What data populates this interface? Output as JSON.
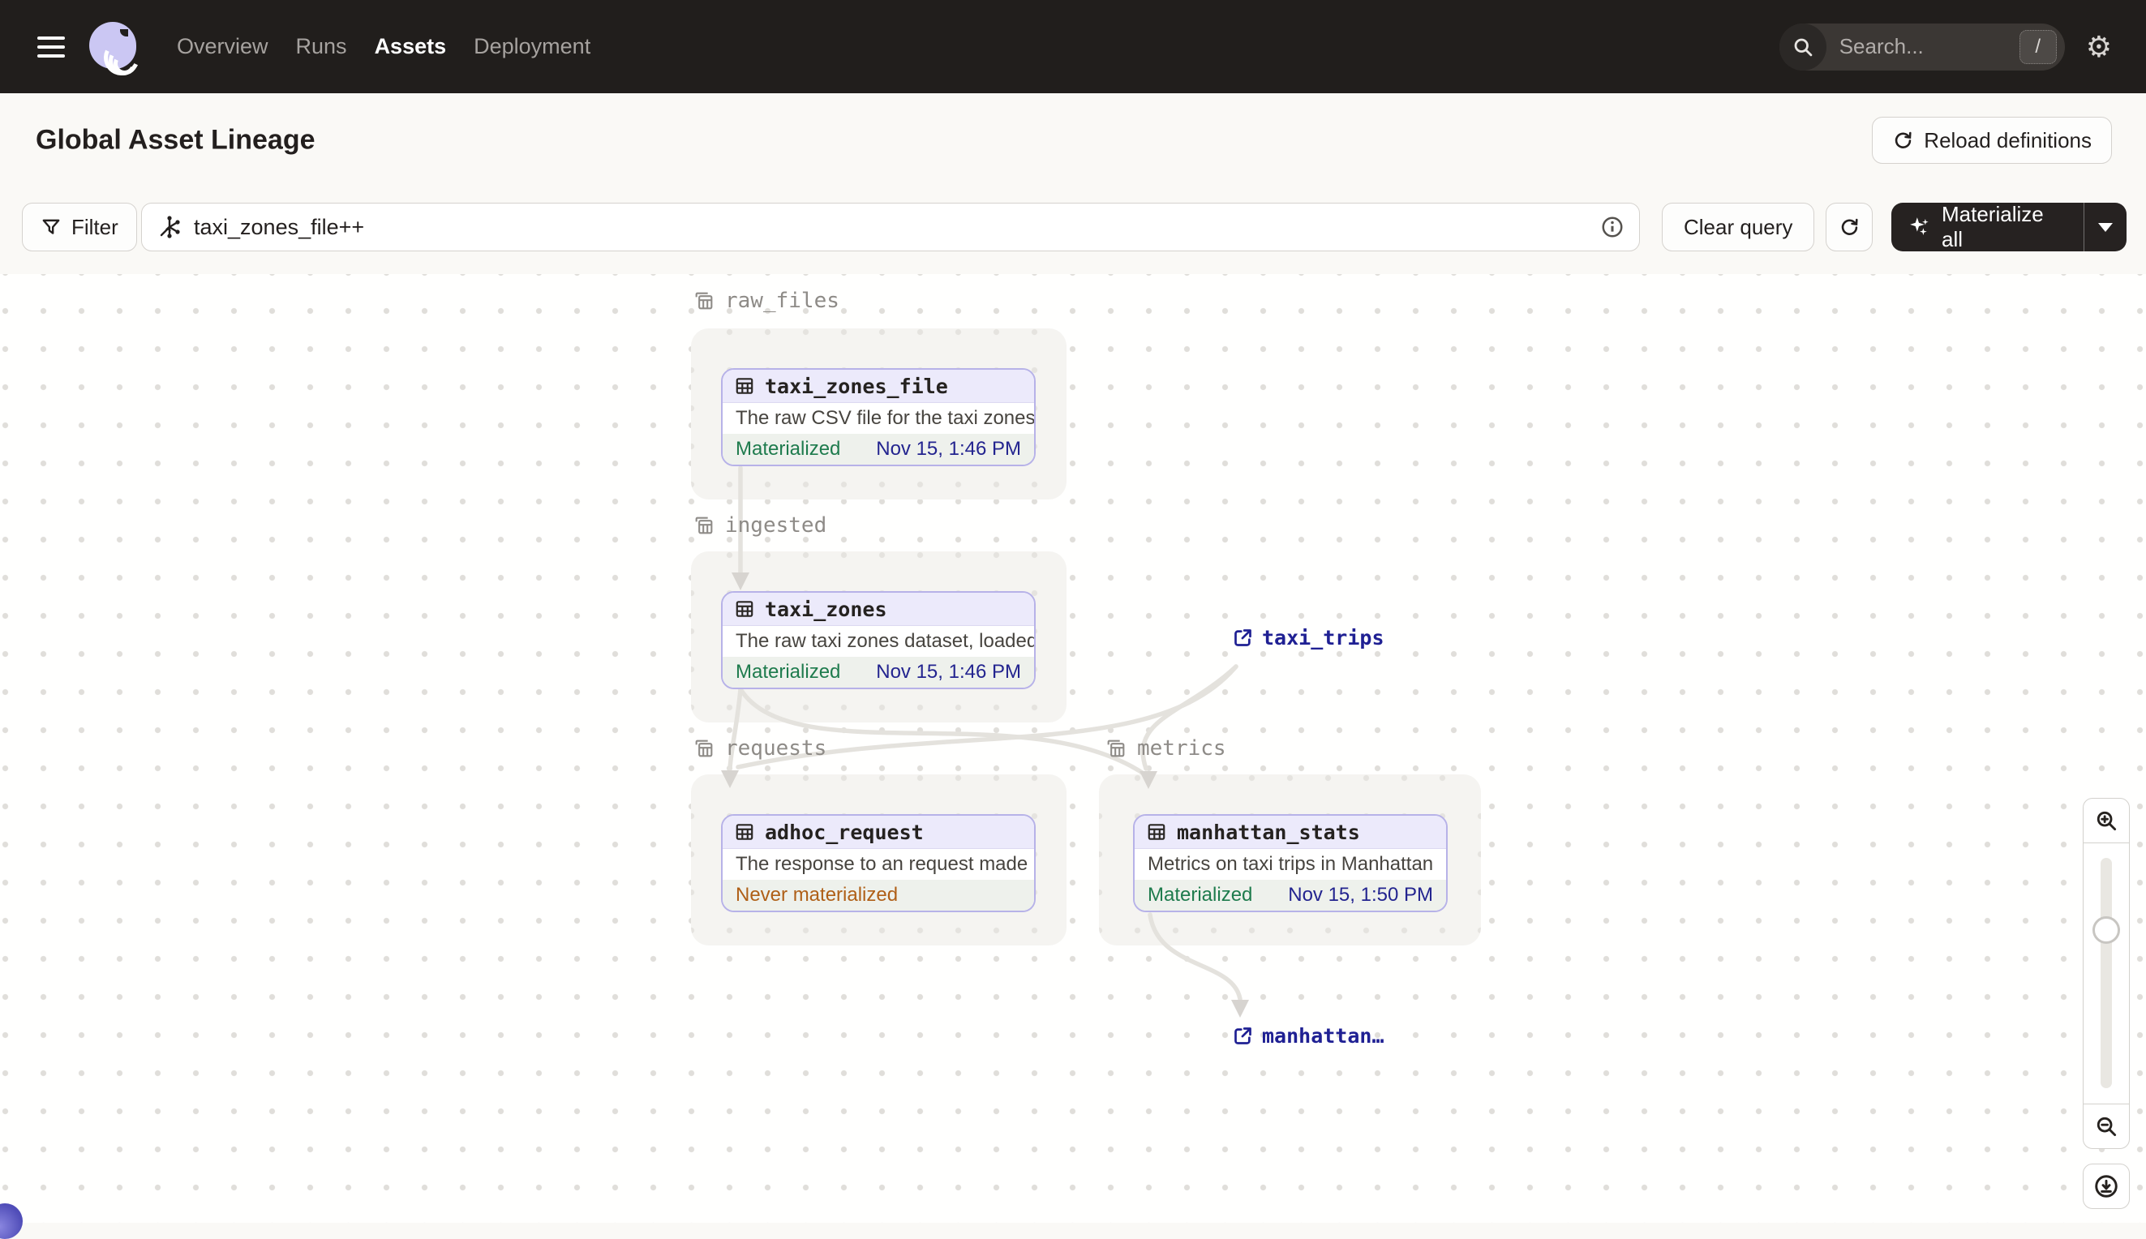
{
  "nav": {
    "items": [
      {
        "label": "Overview"
      },
      {
        "label": "Runs"
      },
      {
        "label": "Assets"
      },
      {
        "label": "Deployment"
      }
    ],
    "active_item": "Assets",
    "search": {
      "placeholder": "Search...",
      "shortcut": "/"
    }
  },
  "header": {
    "title": "Global Asset Lineage",
    "reload_label": "Reload definitions"
  },
  "toolbar": {
    "filter_label": "Filter",
    "query_value": "taxi_zones_file++",
    "clear_label": "Clear query",
    "materialize_label": "Materialize all"
  },
  "graph": {
    "groups": [
      {
        "name": "raw_files"
      },
      {
        "name": "ingested"
      },
      {
        "name": "requests"
      },
      {
        "name": "metrics"
      }
    ],
    "nodes": [
      {
        "name": "taxi_zones_file",
        "group": "raw_files",
        "description": "The raw CSV file for the taxi zones dat…",
        "status": "Materialized",
        "timestamp": "Nov 15, 1:46 PM"
      },
      {
        "name": "taxi_zones",
        "group": "ingested",
        "description": "The raw taxi zones dataset, loaded int…",
        "status": "Materialized",
        "timestamp": "Nov 15, 1:46 PM"
      },
      {
        "name": "adhoc_request",
        "group": "requests",
        "description": "The response to an request made in th…",
        "status": "Never materialized",
        "timestamp": ""
      },
      {
        "name": "manhattan_stats",
        "group": "metrics",
        "description": "Metrics on taxi trips in Manhattan",
        "status": "Materialized",
        "timestamp": "Nov 15, 1:50 PM"
      }
    ],
    "external_assets": [
      {
        "name": "taxi_trips"
      },
      {
        "name": "manhattan…"
      }
    ],
    "edges": [
      {
        "from": "taxi_zones_file",
        "to": "taxi_zones"
      },
      {
        "from": "taxi_zones",
        "to": "adhoc_request"
      },
      {
        "from": "taxi_zones",
        "to": "manhattan_stats"
      },
      {
        "from": "taxi_trips",
        "to": "adhoc_request"
      },
      {
        "from": "taxi_trips",
        "to": "manhattan_stats"
      },
      {
        "from": "manhattan_stats",
        "to": "manhattan…"
      }
    ]
  },
  "icons": {
    "menu": "hamburger-icon",
    "logo": "dagster-logo",
    "search": "search-icon",
    "settings": "gear-icon",
    "reload": "reload-icon",
    "filter": "funnel-icon",
    "query": "graph-query-icon",
    "info": "info-icon",
    "refresh": "refresh-icon",
    "materialize": "sparkle-icon",
    "dropdown": "caret-down-icon",
    "asset": "table-icon",
    "group": "grouped-table-icon",
    "external": "external-link-icon",
    "zoom_in": "zoom-in-icon",
    "zoom_out": "zoom-out-icon",
    "recenter": "recenter-icon"
  },
  "colors": {
    "nav_background": "#211E1C",
    "materialized_green": "#1E7B4D",
    "never_materialized_orange": "#AF5F17",
    "timestamp_indigo": "#23248F",
    "external_link_navy": "#1F2093",
    "node_border_lavender": "#B7B2E8",
    "node_header_lavender": "#ECEAFB"
  }
}
